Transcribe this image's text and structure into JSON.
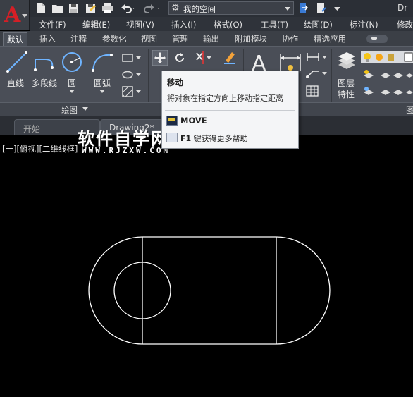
{
  "app": {
    "logo_letter": "A",
    "workspace": "我的空间",
    "doc_title_fragment": "Dr"
  },
  "menu": [
    "文件(F)",
    "编辑(E)",
    "视图(V)",
    "插入(I)",
    "格式(O)",
    "工具(T)",
    "绘图(D)",
    "标注(N)",
    "修改"
  ],
  "ribbon_tabs": [
    "默认",
    "插入",
    "注释",
    "参数化",
    "视图",
    "管理",
    "输出",
    "附加模块",
    "协作",
    "精选应用"
  ],
  "ribbon": {
    "draw_tools": [
      "直线",
      "多段线",
      "圆",
      "圆弧"
    ],
    "draw_panel_title": "绘图",
    "layer_label_1": "图层",
    "layer_label_2": "特性",
    "right_panel_fragment": "图"
  },
  "file_tabs": [
    "开始",
    "Drawing2*"
  ],
  "viewport_label": "[一][俯视][二维线框]",
  "watermark": {
    "title": "软件自学网",
    "url": "WWW.RJZXW.COM"
  },
  "tooltip": {
    "title": "移动",
    "description": "将对象在指定方向上移动指定距离",
    "command": "MOVE",
    "help_key": "F1",
    "help_text": "键获得更多帮助"
  },
  "colors": {
    "canvas": "#000000",
    "ribbon": "#4a4e57",
    "logo_red": "#d41f26",
    "geometry": "#ffffff"
  },
  "icons": [
    "new-file-icon",
    "open-folder-icon",
    "save-icon",
    "save-as-icon",
    "print-icon",
    "undo-icon",
    "redo-icon",
    "gear-icon",
    "line-icon",
    "polyline-icon",
    "circle-icon",
    "arc-icon",
    "move-icon",
    "rotate-icon",
    "trim-icon",
    "text-icon",
    "layer-properties-icon",
    "bulb-icon"
  ]
}
